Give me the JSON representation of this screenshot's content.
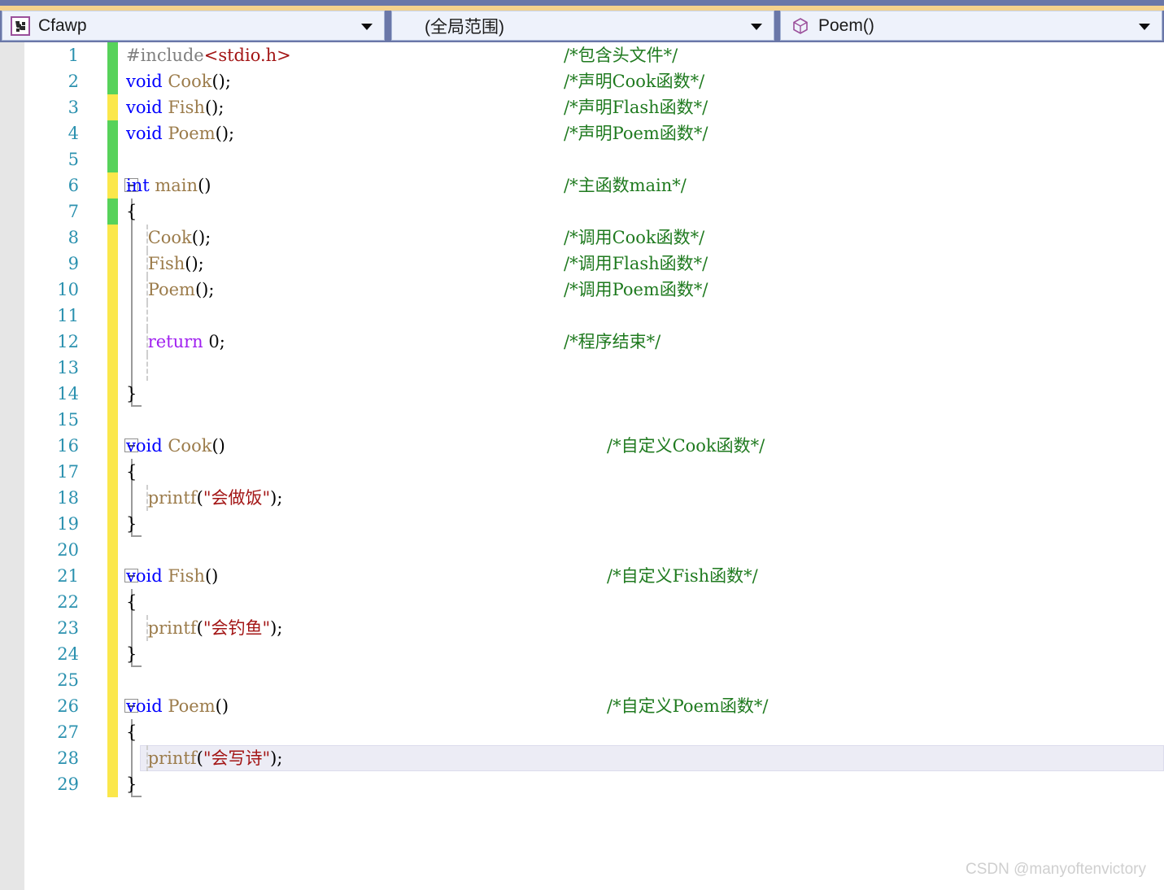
{
  "navbar": {
    "project_combo": {
      "label": "Cfawp",
      "icon": "puzzle-icon"
    },
    "scope_combo": {
      "label": "(全局范围)"
    },
    "member_combo": {
      "label": "Poem()",
      "icon": "cube-icon"
    }
  },
  "editor": {
    "language": "C",
    "current_line": 28,
    "colors": {
      "keyword": "#0000ff",
      "control_keyword": "#a020f0",
      "comment": "#1f7a1f",
      "string": "#a31515",
      "function": "#9b7b4a",
      "preprocessor": "#808080",
      "line_number": "#2b91af",
      "changebar_saved": "#57d25a",
      "changebar_unsaved": "#fbe74b",
      "current_line_highlight": "#ececf5",
      "navbar": "#6a77a8",
      "navbar_accent": "#f5d28c"
    },
    "lines": [
      {
        "n": 1,
        "changebar": "green",
        "fold": "",
        "indent": 0,
        "guide": false,
        "code": "#include<stdio.h>",
        "comment": "/*包含头文件*/",
        "comment_indent": 0
      },
      {
        "n": 2,
        "changebar": "green",
        "fold": "",
        "indent": 0,
        "guide": false,
        "code": "void Cook();",
        "comment": "/*声明Cook函数*/",
        "comment_indent": 0
      },
      {
        "n": 3,
        "changebar": "yellow",
        "fold": "",
        "indent": 0,
        "guide": false,
        "code": "void Fish();",
        "comment": "/*声明Flash函数*/",
        "comment_indent": 0
      },
      {
        "n": 4,
        "changebar": "green",
        "fold": "",
        "indent": 0,
        "guide": false,
        "code": "void Poem();",
        "comment": "/*声明Poem函数*/",
        "comment_indent": 0
      },
      {
        "n": 5,
        "changebar": "green",
        "fold": "",
        "indent": 0,
        "guide": false,
        "code": "",
        "comment": "",
        "comment_indent": 0
      },
      {
        "n": 6,
        "changebar": "yellow",
        "fold": "minus",
        "indent": 0,
        "guide": false,
        "code": "int main()",
        "comment": "/*主函数main*/",
        "comment_indent": 0
      },
      {
        "n": 7,
        "changebar": "green",
        "fold": "line",
        "indent": 0,
        "guide": false,
        "code": "{",
        "comment": "",
        "comment_indent": 0
      },
      {
        "n": 8,
        "changebar": "yellow",
        "fold": "line",
        "indent": 1,
        "guide": true,
        "code": "    Cook();",
        "comment": "/*调用Cook函数*/",
        "comment_indent": 0
      },
      {
        "n": 9,
        "changebar": "yellow",
        "fold": "line",
        "indent": 1,
        "guide": true,
        "code": "    Fish();",
        "comment": "/*调用Flash函数*/",
        "comment_indent": 0
      },
      {
        "n": 10,
        "changebar": "yellow",
        "fold": "line",
        "indent": 1,
        "guide": true,
        "code": "    Poem();",
        "comment": "/*调用Poem函数*/",
        "comment_indent": 0
      },
      {
        "n": 11,
        "changebar": "yellow",
        "fold": "line",
        "indent": 1,
        "guide": true,
        "code": "",
        "comment": "",
        "comment_indent": 0
      },
      {
        "n": 12,
        "changebar": "yellow",
        "fold": "line",
        "indent": 1,
        "guide": true,
        "code": "    return 0;",
        "comment": "/*程序结束*/",
        "comment_indent": 0
      },
      {
        "n": 13,
        "changebar": "yellow",
        "fold": "line",
        "indent": 1,
        "guide": true,
        "code": "",
        "comment": "",
        "comment_indent": 0
      },
      {
        "n": 14,
        "changebar": "yellow",
        "fold": "end",
        "indent": 0,
        "guide": false,
        "code": "}",
        "comment": "",
        "comment_indent": 0
      },
      {
        "n": 15,
        "changebar": "yellow",
        "fold": "",
        "indent": 0,
        "guide": false,
        "code": "",
        "comment": "",
        "comment_indent": 0
      },
      {
        "n": 16,
        "changebar": "yellow",
        "fold": "minus",
        "indent": 0,
        "guide": false,
        "code": "void Cook()",
        "comment": "/*自定义Cook函数*/",
        "comment_indent": 1
      },
      {
        "n": 17,
        "changebar": "yellow",
        "fold": "line",
        "indent": 0,
        "guide": false,
        "code": "{",
        "comment": "",
        "comment_indent": 0
      },
      {
        "n": 18,
        "changebar": "yellow",
        "fold": "line",
        "indent": 1,
        "guide": true,
        "code": "    printf(\"会做饭\");",
        "comment": "",
        "comment_indent": 0
      },
      {
        "n": 19,
        "changebar": "yellow",
        "fold": "end",
        "indent": 0,
        "guide": false,
        "code": "}",
        "comment": "",
        "comment_indent": 0
      },
      {
        "n": 20,
        "changebar": "yellow",
        "fold": "",
        "indent": 0,
        "guide": false,
        "code": "",
        "comment": "",
        "comment_indent": 0
      },
      {
        "n": 21,
        "changebar": "yellow",
        "fold": "minus",
        "indent": 0,
        "guide": false,
        "code": "void Fish()",
        "comment": "/*自定义Fish函数*/",
        "comment_indent": 1
      },
      {
        "n": 22,
        "changebar": "yellow",
        "fold": "line",
        "indent": 0,
        "guide": false,
        "code": "{",
        "comment": "",
        "comment_indent": 0
      },
      {
        "n": 23,
        "changebar": "yellow",
        "fold": "line",
        "indent": 1,
        "guide": true,
        "code": "    printf(\"会钓鱼\");",
        "comment": "",
        "comment_indent": 0
      },
      {
        "n": 24,
        "changebar": "yellow",
        "fold": "end",
        "indent": 0,
        "guide": false,
        "code": "}",
        "comment": "",
        "comment_indent": 0
      },
      {
        "n": 25,
        "changebar": "yellow",
        "fold": "",
        "indent": 0,
        "guide": false,
        "code": "",
        "comment": "",
        "comment_indent": 0
      },
      {
        "n": 26,
        "changebar": "yellow",
        "fold": "minus",
        "indent": 0,
        "guide": false,
        "code": "void Poem()",
        "comment": "/*自定义Poem函数*/",
        "comment_indent": 1
      },
      {
        "n": 27,
        "changebar": "yellow",
        "fold": "line",
        "indent": 0,
        "guide": false,
        "code": "{",
        "comment": "",
        "comment_indent": 0
      },
      {
        "n": 28,
        "changebar": "yellow",
        "fold": "line",
        "indent": 1,
        "guide": true,
        "code": "    printf(\"会写诗\");",
        "comment": "",
        "comment_indent": 0
      },
      {
        "n": 29,
        "changebar": "yellow",
        "fold": "end",
        "indent": 0,
        "guide": false,
        "code": "}",
        "comment": "",
        "comment_indent": 0
      }
    ]
  },
  "watermark": "CSDN @manyoftenvictory"
}
